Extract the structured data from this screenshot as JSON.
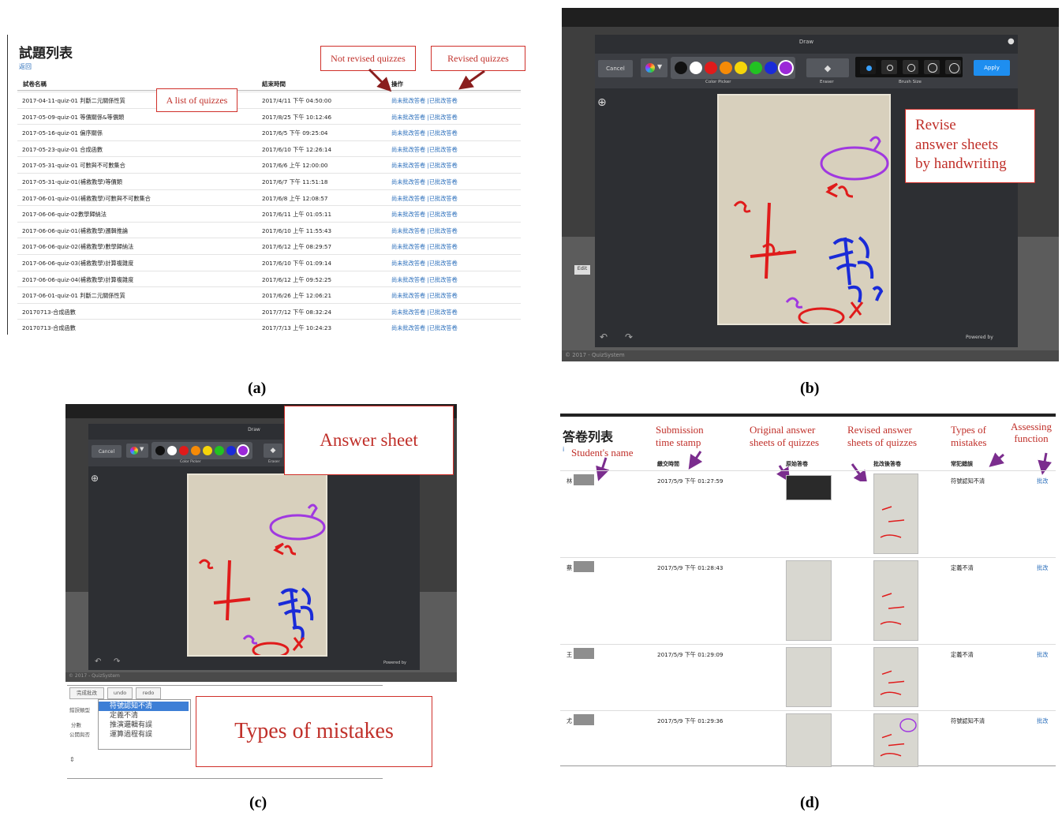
{
  "captions": {
    "a": "(a)",
    "b": "(b)",
    "c": "(c)",
    "d": "(d)"
  },
  "panel_a": {
    "title": "試題列表",
    "back_link": "返回",
    "headers": {
      "name": "試卷名稱",
      "end_time": "結束時間",
      "action": "操作"
    },
    "link_not_revised": "尚未批改答卷",
    "link_separator": " |",
    "link_revised": "已批改答卷",
    "rows": [
      {
        "name": "2017-04-11-quiz-01 判斷二元關係性質",
        "time": "2017/4/11 下午 04:50:00"
      },
      {
        "name": "2017-05-09-quiz-01 等價關係&等價類",
        "time": "2017/8/25 下午 10:12:46"
      },
      {
        "name": "2017-05-16-quiz-01 偏序關係",
        "time": "2017/6/5 下午 09:25:04"
      },
      {
        "name": "2017-05-23-quiz-01 合成函數",
        "time": "2017/6/10 下午 12:26:14"
      },
      {
        "name": "2017-05-31-quiz-01 可數與不可數集合",
        "time": "2017/6/6 上午 12:00:00"
      },
      {
        "name": "2017-05-31-quiz-01(補救教學)等價類",
        "time": "2017/6/7 下午 11:51:18"
      },
      {
        "name": "2017-06-01-quiz-01(補救教學)可數與不可數集合",
        "time": "2017/6/8 上午 12:08:57"
      },
      {
        "name": "2017-06-06-quiz-02數學歸納法",
        "time": "2017/6/11 上午 01:05:11"
      },
      {
        "name": "2017-06-06-quiz-01(補救教學)邏輯推論",
        "time": "2017/6/10 上午 11:55:43"
      },
      {
        "name": "2017-06-06-quiz-02(補救教學)數學歸納法",
        "time": "2017/6/12 上午 08:29:57"
      },
      {
        "name": "2017-06-06-quiz-03(補救教學)計算複雜度",
        "time": "2017/6/10 下午 01:09:14"
      },
      {
        "name": "2017-06-06-quiz-04(補救教學)計算複雜度",
        "time": "2017/6/12 上午 09:52:25"
      },
      {
        "name": "2017-06-01-quiz-01 判斷二元關係性質",
        "time": "2017/6/26 上午 12:06:21"
      },
      {
        "name": "20170713-合成函數",
        "time": "2017/7/12 下午 08:32:24"
      },
      {
        "name": "20170713-合成函數",
        "time": "2017/7/13 上午 10:24:23"
      }
    ],
    "callouts": {
      "not_revised": "Not revised quizzes",
      "revised": "Revised quizzes",
      "list": "A list of quizzes"
    }
  },
  "panel_b": {
    "dialog_title": "Draw",
    "cancel": "Cancel",
    "color_picker_label": "Color Picker",
    "eraser_label": "Eraser",
    "brush_size_label": "Brush Size",
    "apply": "Apply",
    "powered_by": "Powered by",
    "edit_label": "Edit",
    "footer": "© 2017 - QuizSystem",
    "callout": "Revise\nanswer sheets\nby handwriting",
    "colors": [
      "#111111",
      "#ffffff",
      "#e01b1b",
      "#f58a07",
      "#f5d50a",
      "#22c222",
      "#1a2bd8",
      "#9b29d8"
    ]
  },
  "panel_c": {
    "dialog_title": "Draw",
    "cancel": "Cancel",
    "color_picker_label": "Color Picker",
    "eraser_label": "Eraser",
    "powered_by": "Powered by",
    "footer": "© 2017 - QuizSystem",
    "callout_sheet": "Answer sheet",
    "callout_types": "Types of mistakes",
    "buttons": [
      "完成批改",
      "undo",
      "redo"
    ],
    "field_mistake": "錯誤類型",
    "field_score": "分數",
    "field_public": "公開與否",
    "mistake_options": [
      "符號認知不清",
      "定義不清",
      "推演邏輯有誤",
      "運算過程有誤"
    ]
  },
  "panel_d": {
    "title": "答卷列表",
    "headers": {
      "time": "繳交時間",
      "original": "原始答卷",
      "revised": "批改後答卷",
      "mistake": "常犯錯誤"
    },
    "annotations": {
      "student": "Student's name",
      "time": "Submission\ntime stamp",
      "original": "Original answer\nsheets of quizzes",
      "revised": "Revised answer\nsheets of quizzes",
      "types": "Types of\nmistakes",
      "assess": "Assessing\nfunction"
    },
    "rows": [
      {
        "name": "林",
        "time": "2017/5/9 下午 01:27:59",
        "mistake": "符號認知不清",
        "action": "批改"
      },
      {
        "name": "蔡",
        "time": "2017/5/9 下午 01:28:43",
        "mistake": "定義不清",
        "action": "批改"
      },
      {
        "name": "王",
        "time": "2017/5/9 下午 01:29:09",
        "mistake": "定義不清",
        "action": "批改"
      },
      {
        "name": "尤",
        "time": "2017/5/9 下午 01:29:36",
        "mistake": "符號認知不清",
        "action": "批改"
      }
    ]
  }
}
